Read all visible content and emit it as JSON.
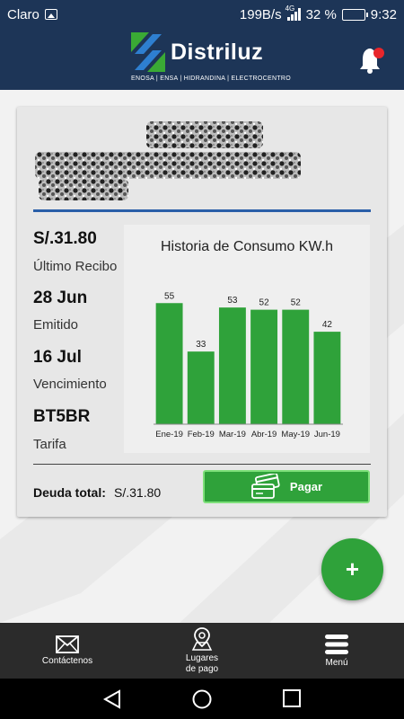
{
  "status_bar": {
    "carrier": "Claro",
    "speed": "199B/s",
    "net_type": "4G",
    "battery": "32 %",
    "battery_level": 0.32,
    "time": "9:32"
  },
  "header": {
    "brand": "Distriluz",
    "subtitle": "ENOSA | ENSA | HIDRANDINA | ELECTROCENTRO",
    "notification_dot": true
  },
  "bill": {
    "amount": "S/.31.80",
    "amount_label": "Último Recibo",
    "issued": "28 Jun",
    "issued_label": "Emitido",
    "due": "16 Jul",
    "due_label": "Vencimiento",
    "tariff": "BT5BR",
    "tariff_label": "Tarifa"
  },
  "debt": {
    "label": "Deuda total:",
    "value": "S/.31.80"
  },
  "pay_button": {
    "label": "Pagar"
  },
  "fab": {
    "label": "+"
  },
  "chart_data": {
    "type": "bar",
    "title": "Historia de Consumo KW.h",
    "categories": [
      "Ene-19",
      "Feb-19",
      "Mar-19",
      "Abr-19",
      "May-19",
      "Jun-19"
    ],
    "values": [
      55,
      33,
      53,
      52,
      52,
      42
    ],
    "ylim": [
      0,
      60
    ],
    "xlabel": "",
    "ylabel": "",
    "color": "#2fa23a",
    "data_labels": true
  },
  "nav": {
    "items": [
      {
        "label": "Contáctenos",
        "icon": "envelope-icon"
      },
      {
        "label_line1": "Lugares",
        "label_line2": "de pago",
        "icon": "map-pin-icon"
      },
      {
        "label": "Menú",
        "icon": "hamburger-menu-icon"
      }
    ]
  },
  "colors": {
    "header": "#1d3557",
    "accent_green": "#2fa23a",
    "divider_blue": "#2a5fa8"
  }
}
